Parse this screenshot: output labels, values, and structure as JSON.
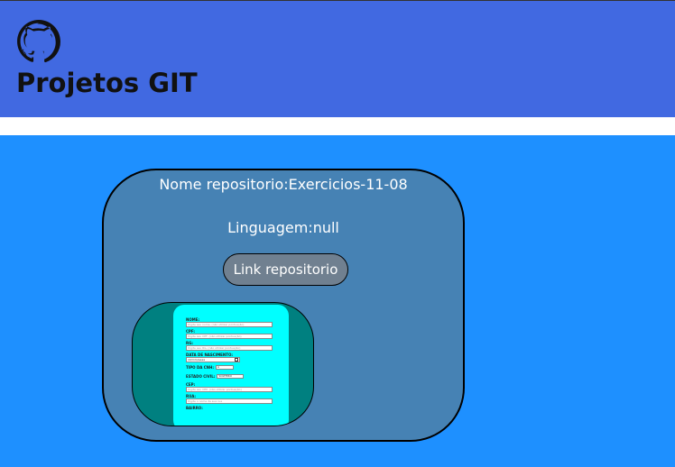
{
  "header": {
    "logo_icon": "github-icon",
    "title": "Projetos GIT",
    "background": "#4169e1"
  },
  "main": {
    "background": "#1e90ff"
  },
  "repo_card": {
    "name_text": "Nome repositorio:Exercicios-11-08",
    "language_text": "Linguagem:null",
    "link_label": "Link repositorio",
    "card_color": "#4682b4",
    "button_color": "#708090"
  },
  "preview": {
    "frame_color": "#008080",
    "page_color": "#00ffff",
    "form": {
      "nome_label": "NOME:",
      "nome_placeholder": "Digite seu nome, (não utilizar pontuação)",
      "cpf_label": "CPF:",
      "cpf_placeholder": "Digite seu CPF, (não utilizar pontuação)",
      "rg_label": "RG:",
      "rg_placeholder": "Digite seu RG, (não utilizar pontuação)",
      "nascimento_label": "DATA DE NASCIMENTO:",
      "nascimento_value": "dd/mm/aaaa",
      "cnh_label": "TIPO DA CNH:",
      "cnh_value": "A",
      "estado_civil_label": "ESTADO CIVIL:",
      "estado_civil_value": "SOLTEIRO",
      "cep_label": "CEP:",
      "cep_placeholder": "Digite seu CEP, (não utilizar pontuação)",
      "rua_label": "RUA:",
      "rua_placeholder": "Digite o nome da sua rua",
      "bairro_label": "BAIRRO:"
    }
  }
}
